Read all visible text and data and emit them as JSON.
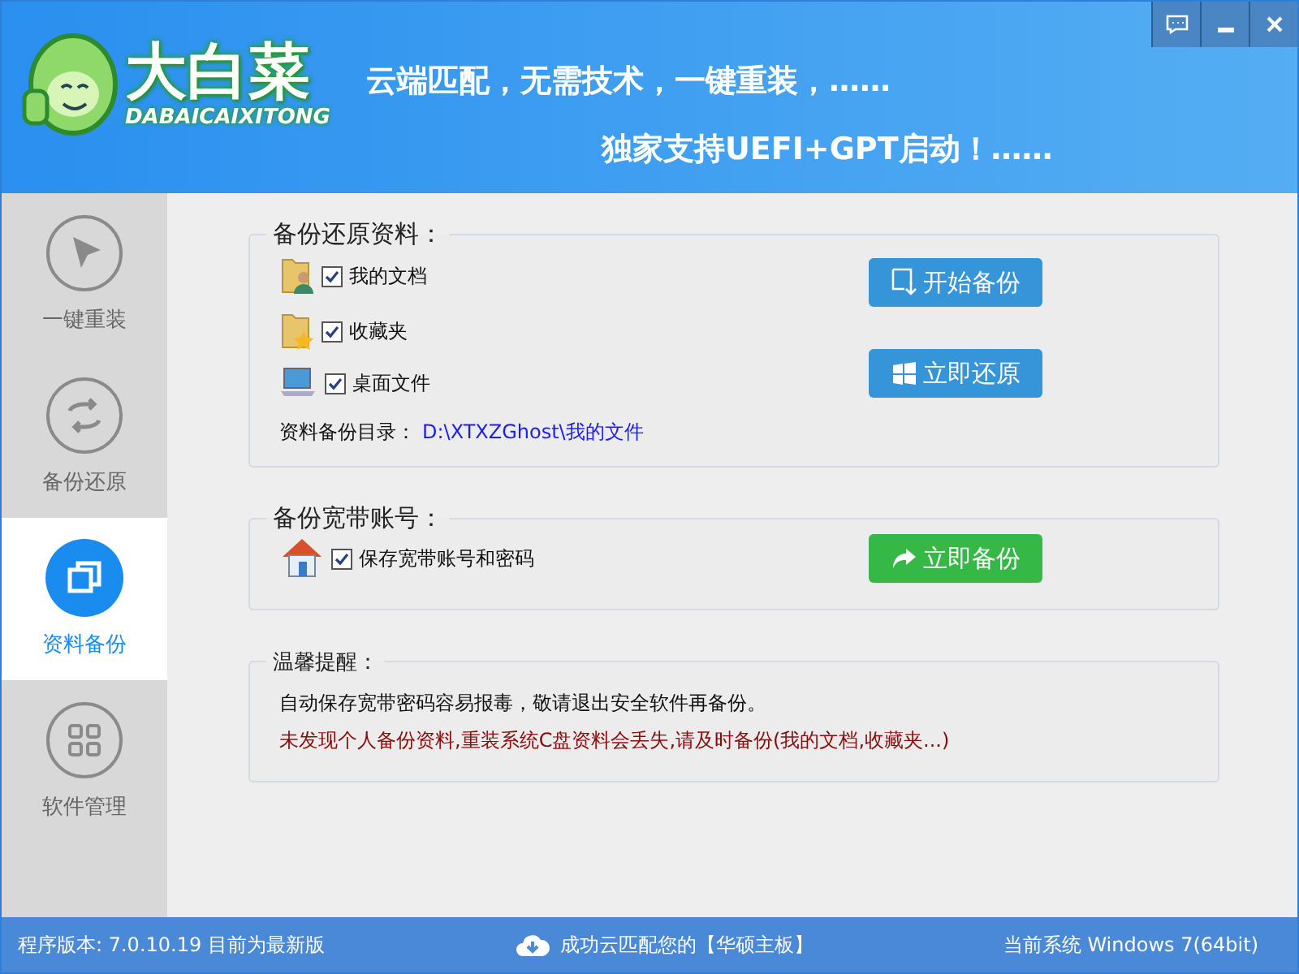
{
  "header": {
    "logo_title": "大白菜",
    "logo_subtitle": "DABAICAIXITONG",
    "slogan_lines": [
      "云端匹配，无需技术，一键重装，……",
      "独家支持UEFI+GPT启动！……"
    ]
  },
  "sidebar": {
    "items": [
      {
        "label": "一键重装",
        "kind": "cursor",
        "selected": false
      },
      {
        "label": "备份还原",
        "kind": "sync",
        "selected": false
      },
      {
        "label": "资料备份",
        "kind": "copy",
        "selected": true
      },
      {
        "label": "软件管理",
        "kind": "grid",
        "selected": false
      }
    ]
  },
  "backup_section": {
    "title": "备份还原资料：",
    "items": [
      {
        "label": "我的文档",
        "kind": "documents",
        "checked": true
      },
      {
        "label": "收藏夹",
        "kind": "favorites",
        "checked": true
      },
      {
        "label": "桌面文件",
        "kind": "desktop",
        "checked": true
      }
    ],
    "buttons": [
      {
        "label": "开始备份",
        "kind": "backup"
      },
      {
        "label": "立即还原",
        "kind": "restore"
      }
    ],
    "directory_label": "资料备份目录：",
    "directory_path": "D:\\XTXZGhost\\我的文件"
  },
  "broadband_section": {
    "title": "备份宽带账号：",
    "item": {
      "label": "保存宽带账号和密码",
      "checked": true
    },
    "button": "立即备份"
  },
  "tips_section": {
    "title": "温馨提醒：",
    "lines": [
      {
        "text": "自动保存宽带密码容易报毒，敬请退出安全软件再备份。",
        "kind": "normal"
      },
      {
        "text": "未发现个人备份资料,重装系统C盘资料会丢失,请及时备份(我的文档,收藏夹...)",
        "kind": "warning"
      }
    ]
  },
  "status_bar": {
    "version": "程序版本: 7.0.10.19 目前为最新版",
    "match": "成功云匹配您的【华硕主板】",
    "system": "当前系统 Windows 7(64bit)"
  }
}
